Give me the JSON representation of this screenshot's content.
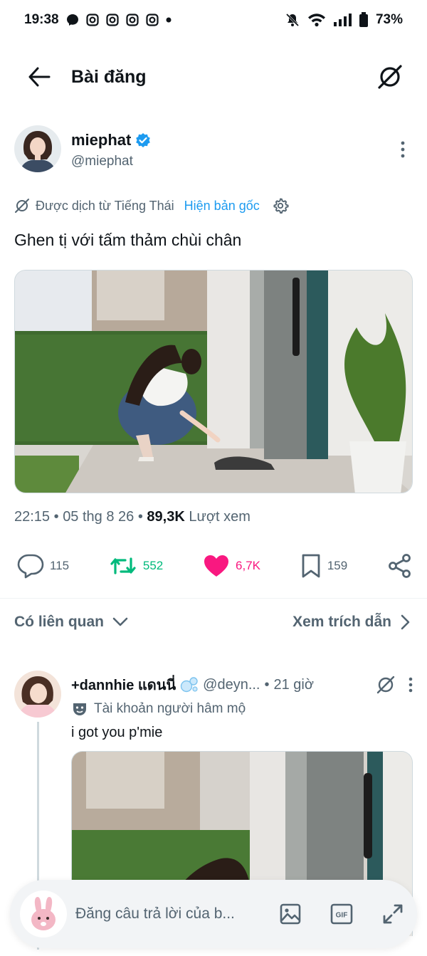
{
  "status_bar": {
    "time": "19:38",
    "battery": "73%"
  },
  "header": {
    "title": "Bài đăng"
  },
  "post": {
    "author_name": "miephat",
    "author_handle": "@miephat",
    "translated_label": "Được dịch từ Tiếng Thái",
    "show_original": "Hiện bản gốc",
    "text": "Ghen tị với tấm thảm chùi chân",
    "time": "22:15",
    "date": "05 thg 8 26",
    "views_count": "89,3K",
    "views_label": "Lượt xem",
    "stats": {
      "replies": "115",
      "reposts": "552",
      "likes": "6,7K",
      "bookmarks": "159"
    }
  },
  "related": {
    "left": "Có liên quan",
    "right": "Xem trích dẫn"
  },
  "reply": {
    "name": "+dannhie แดนนี่",
    "handle": "@deyn...",
    "time": "21 giờ",
    "fan_label": "Tài khoản người hâm mộ",
    "text": "i got you p'mie"
  },
  "compose": {
    "placeholder": "Đăng câu trả lời của b..."
  },
  "colors": {
    "accent": "#1d9bf0",
    "repost": "#00ba7c",
    "like": "#f91880",
    "secondary_text": "#536471"
  }
}
